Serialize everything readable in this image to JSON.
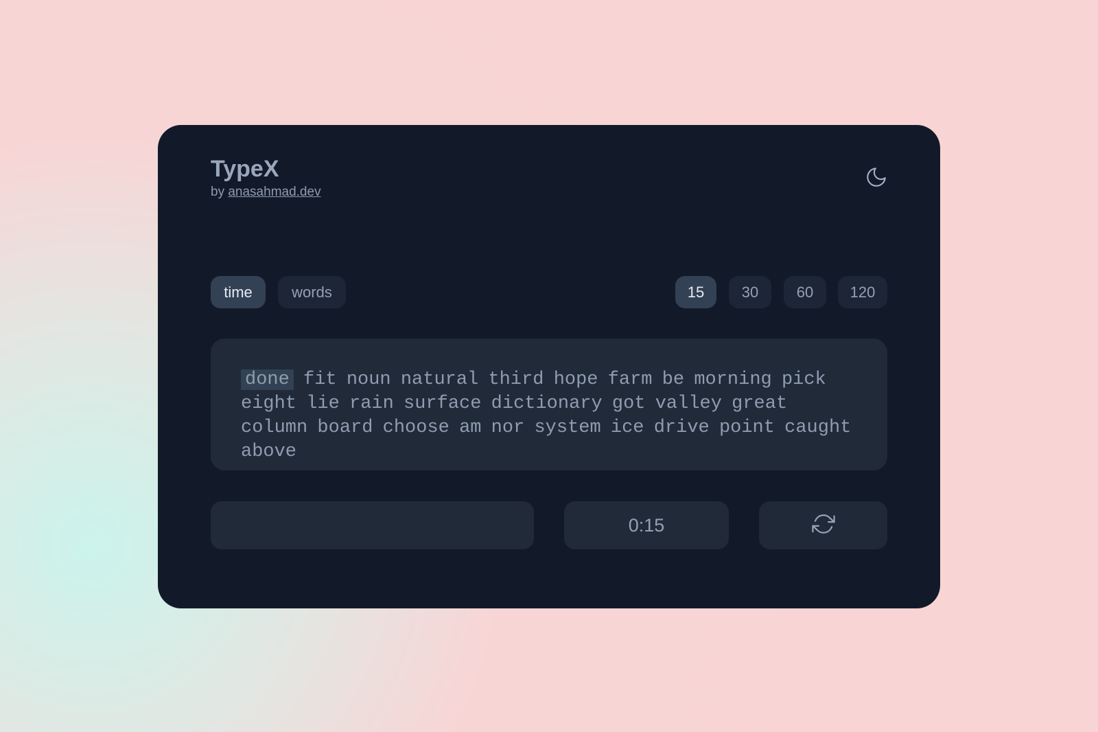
{
  "app": {
    "title": "TypeX",
    "byline_prefix": "by ",
    "author_link": "anasahmad.dev"
  },
  "header": {
    "theme_toggle_icon": "moon-icon"
  },
  "modes": {
    "items": [
      {
        "label": "time",
        "active": true
      },
      {
        "label": "words",
        "active": false
      }
    ]
  },
  "durations": {
    "items": [
      {
        "label": "15",
        "active": true
      },
      {
        "label": "30",
        "active": false
      },
      {
        "label": "60",
        "active": false
      },
      {
        "label": "120",
        "active": false
      }
    ]
  },
  "text": {
    "current_word": "done",
    "remaining_words": [
      "fit",
      "noun",
      "natural",
      "third",
      "hope",
      "farm",
      "be",
      "morning",
      "pick",
      "eight",
      "lie",
      "rain",
      "surface",
      "dictionary",
      "got",
      "valley",
      "great",
      "column",
      "board",
      "choose",
      "am",
      "nor",
      "system",
      "ice",
      "drive",
      "point",
      "caught",
      "above"
    ]
  },
  "input": {
    "value": "",
    "placeholder": ""
  },
  "timer": {
    "display": "0:15"
  },
  "restart": {
    "icon": "refresh-icon"
  },
  "colors": {
    "card_bg": "#121a29",
    "panel_bg": "#202a39",
    "active_pill": "#334155",
    "text": "#8f9cb0"
  }
}
